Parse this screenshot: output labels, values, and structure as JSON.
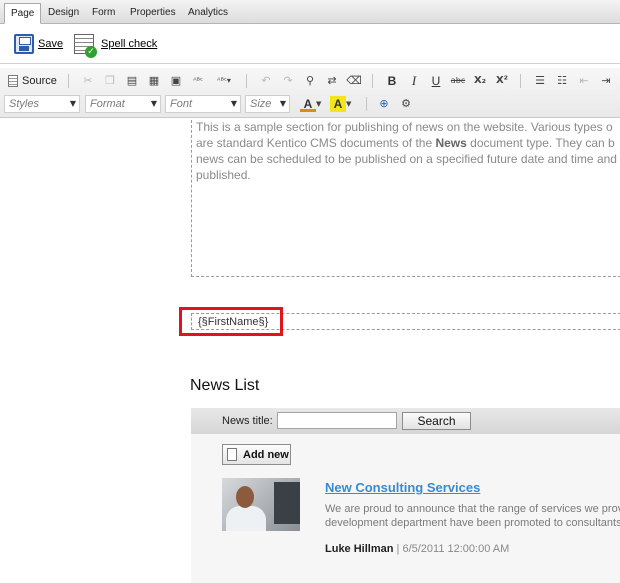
{
  "tabs": [
    {
      "label": "Page",
      "active": true
    },
    {
      "label": "Design",
      "active": false
    },
    {
      "label": "Form",
      "active": false
    },
    {
      "label": "Properties",
      "active": false
    },
    {
      "label": "Analytics",
      "active": false
    }
  ],
  "actions": {
    "save_label": "Save",
    "spellcheck_label": "Spell check"
  },
  "editor_toolbar": {
    "source_label": "Source",
    "styles_placeholder": "Styles",
    "format_placeholder": "Format",
    "font_placeholder": "Font",
    "size_placeholder": "Size",
    "icons": [
      "cut-icon",
      "copy-icon",
      "paste-icon",
      "paste-text-icon",
      "paste-word-icon",
      "spellcheck-icon",
      "scayt-icon",
      "undo-icon",
      "redo-icon",
      "find-icon",
      "replace-icon",
      "remove-format-icon",
      "bold-icon",
      "italic-icon",
      "underline-icon",
      "strike-icon",
      "subscript-icon",
      "superscript-icon",
      "numbered-list-icon",
      "bulleted-list-icon",
      "outdent-icon",
      "indent-icon",
      "text-color-icon",
      "background-color-icon",
      "insert-link-icon",
      "insert-image-icon"
    ],
    "glyphs": {
      "bold": "B",
      "italic": "I",
      "underline": "U",
      "strike": "abc",
      "subscript": "X₂",
      "superscript": "X²",
      "text_color": "A",
      "bg_color": "A"
    },
    "colors": {
      "text_color_bar": "#d98c1a",
      "bg_color_fill": "#f3e51a"
    }
  },
  "content": {
    "section_lines": [
      "This is a sample section for publishing of news on the website. Various types o",
      "are standard Kentico CMS documents of the ",
      "news can be scheduled to be published on a specified future date and time and",
      "published."
    ],
    "section_bold": "News",
    "section_line2_tail": " document type. They can b",
    "macro_text": "{§FirstName§}",
    "news_heading": "News List"
  },
  "news_list": {
    "filter_label": "News title:",
    "filter_value": "",
    "search_label": "Search",
    "add_new_label": "Add new",
    "item": {
      "title": "New Consulting Services",
      "summary_lines": [
        "We are proud to announce that the range of services we prov",
        "development department have been promoted to consultants"
      ],
      "author": "Luke Hillman",
      "separator": " | ",
      "date": "6/5/2011 12:00:00 AM"
    }
  },
  "highlight_color": "#e0141b"
}
